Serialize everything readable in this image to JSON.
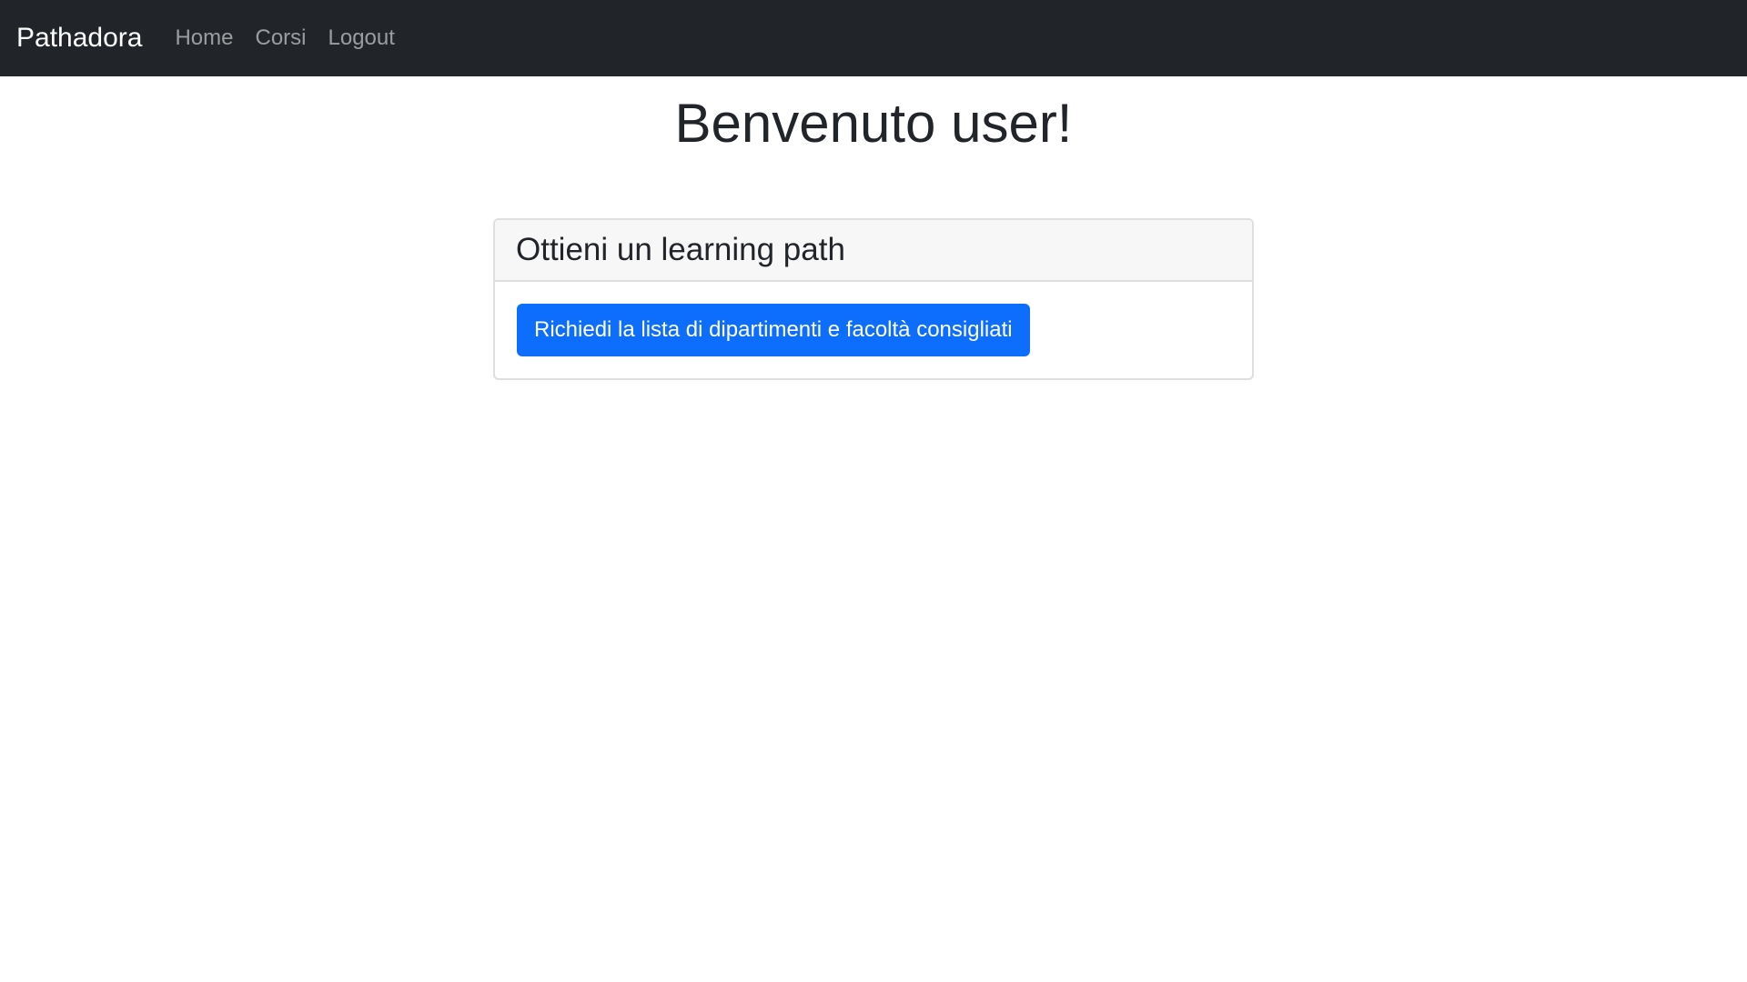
{
  "navbar": {
    "brand": "Pathadora",
    "links": [
      {
        "label": "Home"
      },
      {
        "label": "Corsi"
      },
      {
        "label": "Logout"
      }
    ]
  },
  "main": {
    "title": "Benvenuto user!",
    "card": {
      "header": "Ottieni un learning path",
      "button_label": "Richiedi la lista di dipartimenti e facoltà consigliati"
    }
  },
  "colors": {
    "navbar_bg": "#212529",
    "primary": "#0d6efd",
    "card_header_bg": "#f7f7f7"
  }
}
